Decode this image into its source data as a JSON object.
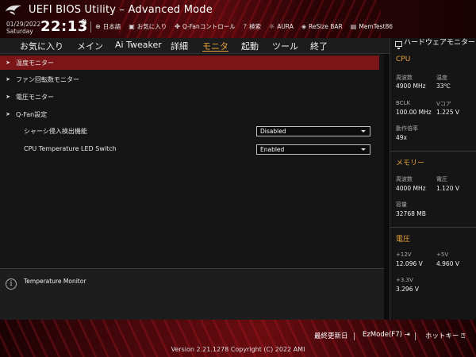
{
  "header": {
    "title": "UEFI BIOS Utility – Advanced Mode",
    "date": "01/29/2022",
    "day": "Saturday",
    "time": "22:13",
    "tools": [
      {
        "icon": "globe-icon",
        "label": "日本語"
      },
      {
        "icon": "favorite-icon",
        "label": "お気に入り"
      },
      {
        "icon": "fan-icon",
        "label": "Q-Fanコントロール"
      },
      {
        "icon": "search-icon",
        "label": "検索"
      },
      {
        "icon": "aura-icon",
        "label": "AURA"
      },
      {
        "icon": "resize-bar-icon",
        "label": "ReSize BAR"
      },
      {
        "icon": "memtest-icon",
        "label": "MemTest86"
      }
    ]
  },
  "tabs": [
    {
      "label": "お気に入り"
    },
    {
      "label": "メイン"
    },
    {
      "label": "Ai Tweaker"
    },
    {
      "label": "詳細"
    },
    {
      "label": "モニタ",
      "active": true
    },
    {
      "label": "起動"
    },
    {
      "label": "ツール"
    },
    {
      "label": "終了"
    }
  ],
  "menu": [
    {
      "label": "温度モニター",
      "selected": true
    },
    {
      "label": "ファン回転数モニター"
    },
    {
      "label": "電圧モニター"
    },
    {
      "label": "Q-Fan設定"
    }
  ],
  "settings": [
    {
      "label": "シャーシ侵入検出機能",
      "value": "Disabled"
    },
    {
      "label": "CPU Temperature LED Switch",
      "value": "Enabled"
    }
  ],
  "help": {
    "text": "Temperature Monitor"
  },
  "hw": {
    "title": "ハードウェアモニター",
    "cpu": {
      "heading": "CPU",
      "freq_label": "周波数",
      "freq": "4900 MHz",
      "temp_label": "温度",
      "temp": "33℃",
      "bclk_label": "BCLK",
      "bclk": "100.00 MHz",
      "vcore_label": "Vコア",
      "vcore": "1.225 V",
      "ratio_label": "動作倍率",
      "ratio": "49x"
    },
    "memory": {
      "heading": "メモリー",
      "freq_label": "周波数",
      "freq": "4000 MHz",
      "volt_label": "電圧",
      "volt": "1.120 V",
      "cap_label": "容量",
      "cap": "32768 MB"
    },
    "voltage": {
      "heading": "電圧",
      "v12_label": "+12V",
      "v12": "12.096 V",
      "v5_label": "+5V",
      "v5": "4.960 V",
      "v33_label": "+3.3V",
      "v33": "3.296 V"
    }
  },
  "footer": {
    "last_modified": "最終更新日",
    "ezmode": "EzMode(F7)",
    "hotkeys": "ホットキー",
    "copyright": "Version 2.21.1278 Copyright (C) 2022 AMI"
  },
  "colors": {
    "accent": "#e8a23a",
    "selected_row": "#7a1518",
    "brand_red": "#6a0c10"
  }
}
